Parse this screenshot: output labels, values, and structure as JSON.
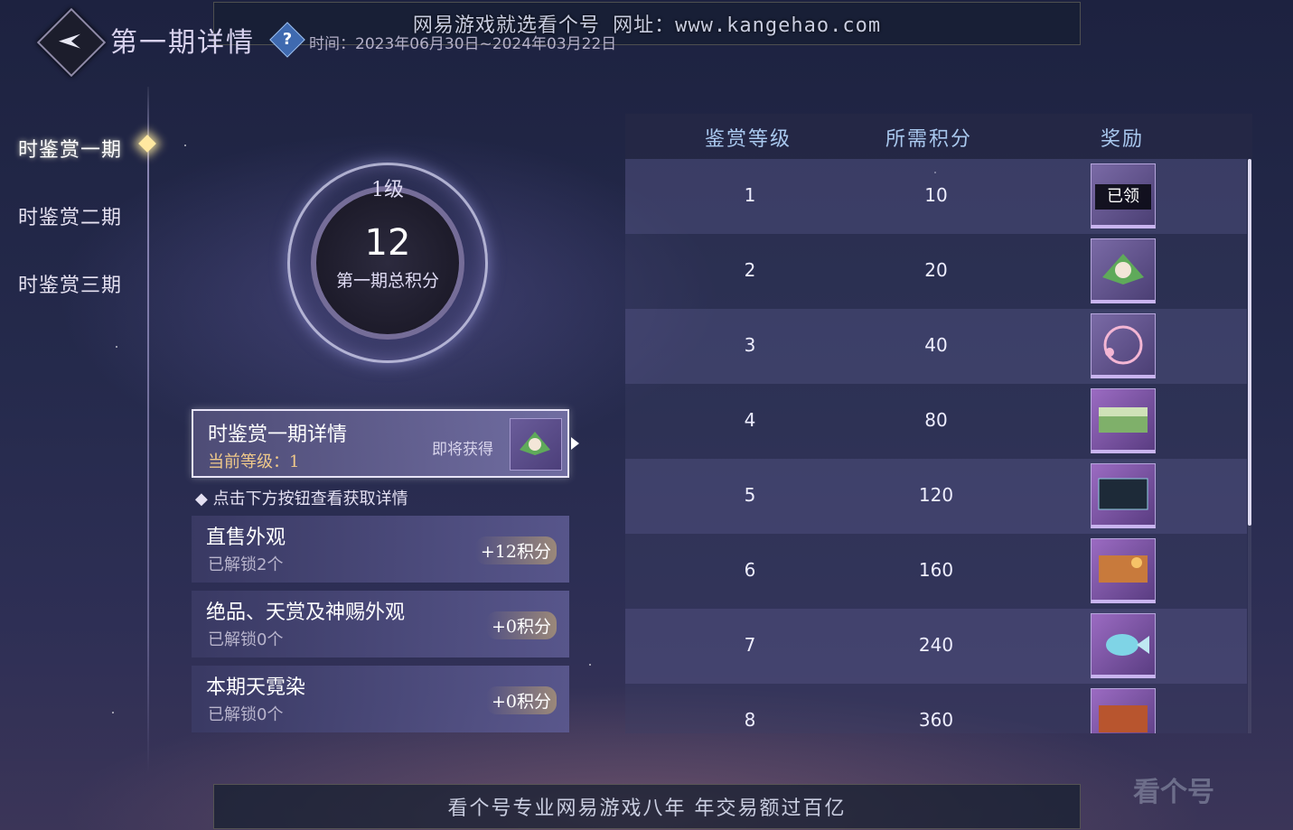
{
  "banner_top": "网易游戏就选看个号  网址：www.kangehao.com",
  "banner_bottom": "看个号专业网易游戏八年  年交易额过百亿",
  "header": {
    "title": "第一期详情",
    "help_symbol": "?",
    "time": "时间：2023年06月30日~2024年03月22日"
  },
  "sidebar": {
    "items": [
      {
        "label": "时鉴赏一期"
      },
      {
        "label": "时鉴赏二期"
      },
      {
        "label": "时鉴赏三期"
      }
    ]
  },
  "ring": {
    "level": "1级",
    "value": "12",
    "label": "第一期总积分"
  },
  "detail_card": {
    "title": "时鉴赏一期详情",
    "current_level": "当前等级：1",
    "soon": "即将获得"
  },
  "hint": "◆ 点击下方按钮查看获取详情",
  "sources": [
    {
      "title": "直售外观",
      "unlocked": "已解锁2个",
      "points": "+12积分"
    },
    {
      "title": "绝品、天赏及神赐外观",
      "unlocked": "已解锁0个",
      "points": "+0积分"
    },
    {
      "title": "本期天霓染",
      "unlocked": "已解锁0个",
      "points": "+0积分"
    }
  ],
  "table": {
    "headers": [
      "鉴赏等级",
      "所需积分",
      "奖励"
    ],
    "rows": [
      {
        "level": "1",
        "points": "10",
        "reward": "已领"
      },
      {
        "level": "2",
        "points": "20",
        "reward": ""
      },
      {
        "level": "3",
        "points": "40",
        "reward": ""
      },
      {
        "level": "4",
        "points": "80",
        "reward": ""
      },
      {
        "level": "5",
        "points": "120",
        "reward": ""
      },
      {
        "level": "6",
        "points": "160",
        "reward": ""
      },
      {
        "level": "7",
        "points": "240",
        "reward": ""
      },
      {
        "level": "8",
        "points": "360",
        "reward": ""
      }
    ]
  },
  "watermark": "看个号",
  "colors": {
    "accent_gold": "#f0c98a",
    "header_blue": "#a9c8ee"
  }
}
